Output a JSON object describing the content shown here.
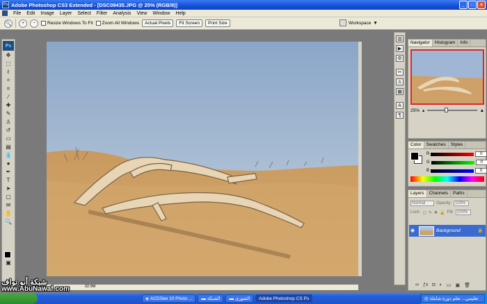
{
  "window": {
    "title": "Adobe Photoshop CS3 Extended - [DSC09435.JPG @ 25% (RGB/8)]",
    "app_badge": "Ps"
  },
  "menu": [
    "File",
    "Edit",
    "Image",
    "Layer",
    "Select",
    "Filter",
    "Analysis",
    "View",
    "Window",
    "Help"
  ],
  "options": {
    "resize_windows": "Resize Windows To Fit",
    "zoom_all": "Zoom All Windows",
    "actual_pixels": "Actual Pixels",
    "fit_screen": "Fit Screen",
    "print_size": "Print Size",
    "workspace": "Workspace"
  },
  "status": {
    "doc_size": "02.9M"
  },
  "navigator": {
    "tabs": [
      "Navigator",
      "Histogram",
      "Info"
    ],
    "zoom": "25%",
    "slider_level": 0.34
  },
  "color": {
    "tabs": [
      "Color",
      "Swatches",
      "Styles"
    ],
    "channels": [
      {
        "label": "R",
        "value": "0"
      },
      {
        "label": "G",
        "value": "0"
      },
      {
        "label": "B",
        "value": "0"
      }
    ]
  },
  "layers": {
    "tabs": [
      "Layers",
      "Channels",
      "Paths"
    ],
    "blend_mode": "Normal",
    "opacity_label": "Opacity:",
    "opacity": "100%",
    "lock_label": "Lock:",
    "fill_label": "Fill:",
    "fill": "100%",
    "layer_name": "Background"
  },
  "watermark": {
    "line1": "شبكة أبو نواف",
    "line2": "www.AbuNawaf.com"
  },
  "taskbar": {
    "items": [
      "ACDSee 10 Photo ...",
      "الشبكة",
      "الشورى",
      "Adobe Photoshop CS",
      "تعليمي... تعلم دورة شاملة"
    ]
  },
  "colors": {
    "sky_top": "#8aa6c8",
    "sand": "#c9995e",
    "highlight_layer": "#3a6bd0",
    "nav_view_box": "#e0242a"
  }
}
